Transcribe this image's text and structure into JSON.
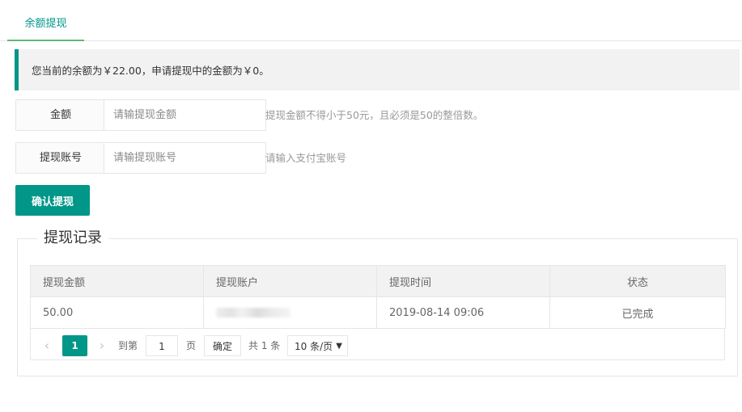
{
  "tabs": [
    {
      "label": "余额提现",
      "active": true
    }
  ],
  "notice": {
    "text": "您当前的余额为￥22.00，申请提现中的金额为￥0。"
  },
  "form": {
    "amount": {
      "label": "金额",
      "placeholder": "请输提现金额",
      "tip": "提现金额不得小于50元，且必须是50的整倍数。"
    },
    "account": {
      "label": "提现账号",
      "placeholder": "请输提现账号",
      "tip": "请输入支付宝账号"
    },
    "submit_label": "确认提现"
  },
  "records": {
    "legend": "提现记录",
    "columns": [
      "提现金额",
      "提现账户",
      "提现时间",
      "状态"
    ],
    "rows": [
      {
        "amount": "50.00",
        "account": "",
        "time": "2019-08-14 09:06",
        "status": "已完成"
      }
    ]
  },
  "pager": {
    "prev_icon": "chevron-left-icon",
    "next_icon": "chevron-right-icon",
    "current_page": "1",
    "goto_prefix": "到第",
    "goto_value": "1",
    "goto_suffix": "页",
    "goto_button": "确定",
    "total_text": "共 1 条",
    "page_size": "10 条/页",
    "page_size_arrow": "▼"
  },
  "colors": {
    "accent": "#009688",
    "tab_underline": "#5FB878",
    "notice_bg": "#f2f2f2"
  }
}
